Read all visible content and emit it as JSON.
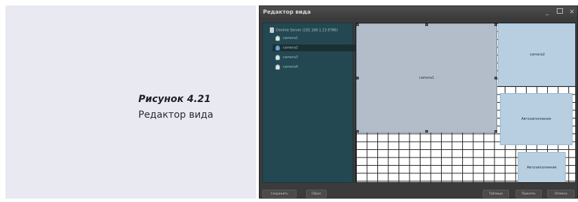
{
  "caption": {
    "title": "Рисунок 4.21",
    "text": "Редактор вида"
  },
  "window": {
    "title": "Редактор вида",
    "controls": {
      "minimize": "_",
      "close": "✕"
    }
  },
  "tree": {
    "server_label": "Devline Server (192.168.1.23:9786)",
    "items": [
      {
        "label": "camera1"
      },
      {
        "label": "camera2"
      },
      {
        "label": "camera3"
      },
      {
        "label": "camera4"
      }
    ]
  },
  "layout": {
    "cells": [
      {
        "label": "camera1"
      },
      {
        "label": "camera2"
      },
      {
        "label": "Автозаполнение"
      },
      {
        "label": "Автозаполнение"
      }
    ]
  },
  "buttons": {
    "save": "Сохранить",
    "reset": "Сброс",
    "table": "Таблица",
    "apply": "Принять",
    "cancel": "Отмена"
  },
  "colors": {
    "caption_bg": "#e9e9f1",
    "tree_bg": "#234851",
    "cell_selected": "#b3bcc9",
    "cell_other": "#b7cfe1"
  }
}
